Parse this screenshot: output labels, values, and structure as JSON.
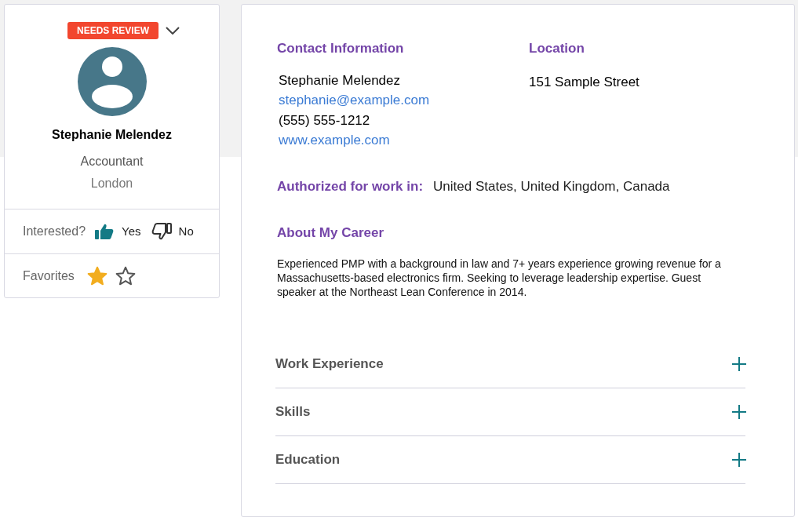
{
  "profile_card": {
    "status_badge": "NEEDS REVIEW",
    "name": "Stephanie Melendez",
    "title": "Accountant",
    "city": "London",
    "interested": {
      "label": "Interested?",
      "options": [
        {
          "kind": "thumbs_up",
          "label": "Yes",
          "selected": true
        },
        {
          "kind": "thumbs_down",
          "label": "No",
          "selected": false
        }
      ]
    },
    "favorites": {
      "label": "Favorites",
      "toggles": [
        {
          "on": true
        },
        {
          "on": false
        }
      ]
    }
  },
  "details": {
    "contact": {
      "heading": "Contact Information",
      "name": "Stephanie Melendez",
      "email": "stephanie@example.com",
      "phone": "(555) 555-1212",
      "website": "www.example.com"
    },
    "location": {
      "heading": "Location",
      "address": "151 Sample Street"
    },
    "authorized": {
      "label": "Authorized for work in:",
      "value": "United States, United Kingdom, Canada"
    },
    "about": {
      "heading": "About My Career",
      "text": "Experienced PMP with a background in law and 7+ years experience growing revenue for a Massachusetts-based electronics firm. Seeking to leverage leadership expertise. Guest speaker at the Northeast Lean Conference in 2014."
    },
    "sections": [
      {
        "label": "Work Experience",
        "expanded": false
      },
      {
        "label": "Skills",
        "expanded": false
      },
      {
        "label": "Education",
        "expanded": false
      }
    ]
  }
}
